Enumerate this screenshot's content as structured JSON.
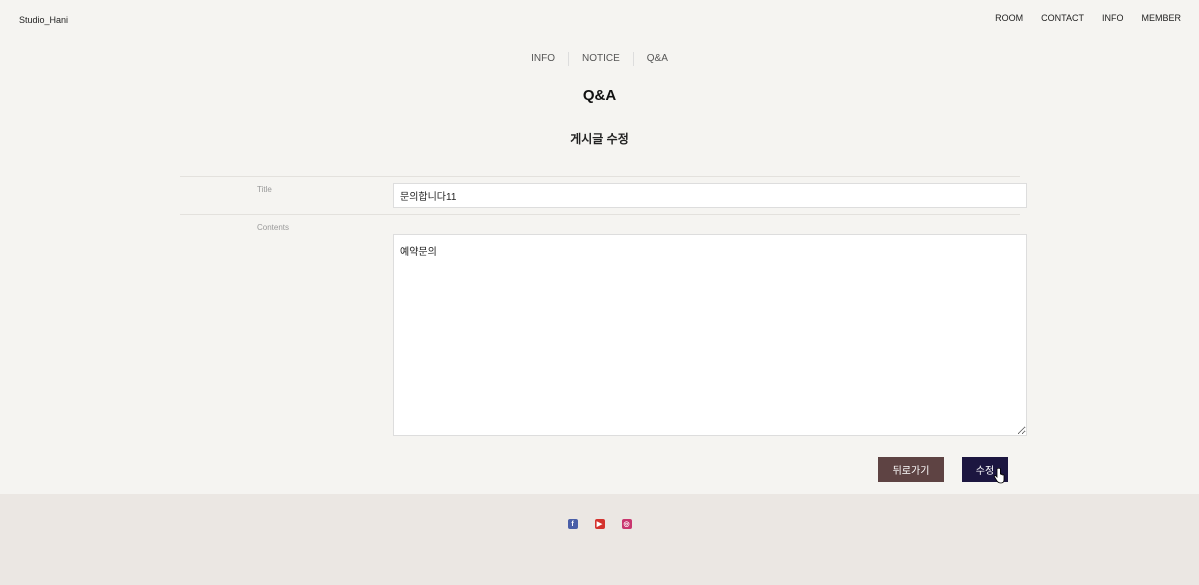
{
  "header": {
    "brand": "Studio_Hani",
    "nav": [
      "ROOM",
      "CONTACT",
      "INFO",
      "MEMBER"
    ]
  },
  "subnav": [
    "INFO",
    "NOTICE",
    "Q&A"
  ],
  "page": {
    "title": "Q&A",
    "subtitle": "게시글 수정"
  },
  "form": {
    "title_label": "Title",
    "title_value": "문의합니다11",
    "contents_label": "Contents",
    "contents_value": "예약문의"
  },
  "buttons": {
    "back": "뒤로가기",
    "submit": "수정"
  },
  "footer": {
    "social_icons": [
      "facebook-icon",
      "youtube-icon",
      "instagram-icon"
    ],
    "colors": {
      "facebook": "#4a5fa8",
      "youtube": "#d4332e",
      "instagram": "#c9366f"
    }
  }
}
